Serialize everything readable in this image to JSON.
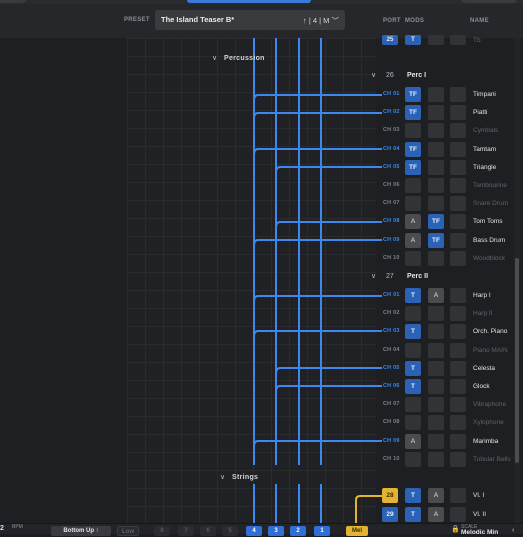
{
  "header": {
    "preset_label": "PRESET",
    "preset_name": "The Island Teaser B*",
    "preset_suffix": "↑ | 4 | M ﹀",
    "port_label": "PORT",
    "mods_label": "MODS",
    "name_label": "NAME"
  },
  "top_partial": {
    "port": "25",
    "mod": "T",
    "name": "Tb"
  },
  "sections": {
    "percussion": "Percussion",
    "strings": "Strings"
  },
  "groups": [
    {
      "num": "26",
      "name": "Perc I"
    },
    {
      "num": "27",
      "name": "Perc II"
    }
  ],
  "perc1_rows": [
    {
      "ch": "CH 01",
      "m1": "TF",
      "m2": "",
      "name": "Timpani"
    },
    {
      "ch": "CH 02",
      "m1": "TF",
      "m2": "",
      "name": "Piatti"
    },
    {
      "ch": "CH 03",
      "m1": "",
      "m2": "",
      "name": "Cymbals"
    },
    {
      "ch": "CH 04",
      "m1": "TF",
      "m2": "",
      "name": "Tamtam"
    },
    {
      "ch": "CH 05",
      "m1": "TF",
      "m2": "",
      "name": "Triangle"
    },
    {
      "ch": "CH 06",
      "m1": "",
      "m2": "",
      "name": "Tambourine"
    },
    {
      "ch": "CH 07",
      "m1": "",
      "m2": "",
      "name": "Snare Drum"
    },
    {
      "ch": "CH 08",
      "m1": "A",
      "m2": "TF",
      "name": "Tom Toms"
    },
    {
      "ch": "CH 09",
      "m1": "A",
      "m2": "TF",
      "name": "Bass Drum"
    },
    {
      "ch": "CH 10",
      "m1": "",
      "m2": "",
      "name": "Woodblock"
    }
  ],
  "perc2_rows": [
    {
      "ch": "CH 01",
      "m1": "T",
      "m2": "A",
      "name": "Harp I"
    },
    {
      "ch": "CH 02",
      "m1": "",
      "m2": "",
      "name": "Harp II"
    },
    {
      "ch": "CH 03",
      "m1": "T",
      "m2": "",
      "name": "Orch. Piano"
    },
    {
      "ch": "CH 04",
      "m1": "",
      "m2": "",
      "name": "Piano MAIN"
    },
    {
      "ch": "CH 05",
      "m1": "T",
      "m2": "",
      "name": "Celesta"
    },
    {
      "ch": "CH 06",
      "m1": "T",
      "m2": "",
      "name": "Glock"
    },
    {
      "ch": "CH 07",
      "m1": "",
      "m2": "",
      "name": "Vibraphone"
    },
    {
      "ch": "CH 08",
      "m1": "",
      "m2": "",
      "name": "Xylophone"
    },
    {
      "ch": "CH 09",
      "m1": "A",
      "m2": "",
      "name": "Marimba"
    },
    {
      "ch": "CH 10",
      "m1": "",
      "m2": "",
      "name": "Tubular Bells"
    }
  ],
  "strings_rows": [
    {
      "port": "28",
      "m1": "T",
      "m2": "A",
      "name": "Vl. I"
    },
    {
      "port": "29",
      "m1": "T",
      "m2": "A",
      "name": "Vl. II"
    }
  ],
  "bottom": {
    "bpm_value": "2",
    "bpm_label": "BPM",
    "mode_label": "Bottom Up ↑",
    "low_label": "Low",
    "steps": [
      "8",
      "7",
      "6",
      "5",
      "4",
      "3",
      "2",
      "1"
    ],
    "mel_label": "Mel",
    "scale_label": "SCALE",
    "scale_value": "Melodic Min"
  },
  "colors": {
    "accent": "#3b7ad8",
    "line": "#3d87f0",
    "active_ch": "#3e86ec",
    "mel": "#e3b431"
  }
}
